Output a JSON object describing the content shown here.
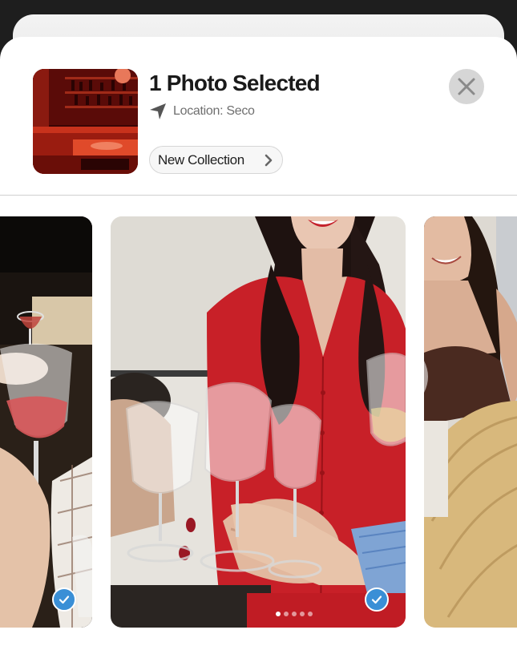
{
  "header": {
    "title": "1 Photo Selected",
    "location": "Location: Seco",
    "new_collection_label": "New Collection"
  },
  "icons": {
    "location": "location-arrow-icon",
    "chevron": "chevron-right-icon",
    "close": "close-icon",
    "check": "checkmark-icon"
  },
  "carousel": {
    "page_count": 5,
    "active_page": 1,
    "photos": [
      {
        "position": "previous",
        "selected": true
      },
      {
        "position": "current",
        "selected": true
      },
      {
        "position": "next",
        "selected": false
      }
    ]
  },
  "colors": {
    "accent_check": "#3a8fd6",
    "close_button_bg": "#d6d6d6",
    "dress_red": "#c82028",
    "lipstick": "#b81d2a"
  }
}
